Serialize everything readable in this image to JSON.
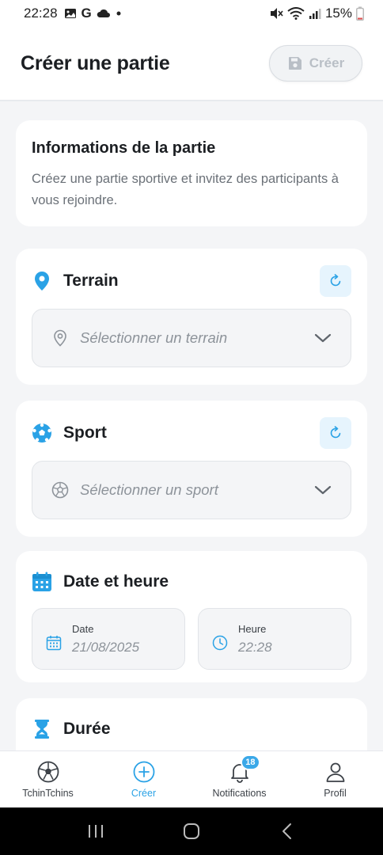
{
  "status": {
    "time": "22:28",
    "battery": "15%",
    "left_icons": [
      "gallery-icon",
      "google-g-icon",
      "cloud-icon",
      "dot-icon"
    ],
    "right_icons": [
      "mute-icon",
      "wifi-icon",
      "signal-icon",
      "battery-icon"
    ]
  },
  "header": {
    "title": "Créer une partie",
    "create_label": "Créer",
    "create_icon": "save-icon"
  },
  "info": {
    "title": "Informations de la partie",
    "description": "Créez une partie sportive et invitez des participants à vous rejoindre."
  },
  "terrain": {
    "label": "Terrain",
    "placeholder": "Sélectionner un terrain",
    "icon": "location-pin-icon"
  },
  "sport": {
    "label": "Sport",
    "placeholder": "Sélectionner un sport",
    "icon": "soccer-ball-icon"
  },
  "datetime": {
    "label": "Date et heure",
    "date_caption": "Date",
    "date_value": "21/08/2025",
    "time_caption": "Heure",
    "time_value": "22:28"
  },
  "duration": {
    "label": "Durée"
  },
  "tabs": [
    {
      "label": "TchinTchins",
      "icon": "soccer-ball-icon",
      "active": false
    },
    {
      "label": "Créer",
      "icon": "plus-circle-icon",
      "active": true
    },
    {
      "label": "Notifications",
      "icon": "bell-icon",
      "active": false,
      "badge": "18"
    },
    {
      "label": "Profil",
      "icon": "user-icon",
      "active": false
    }
  ],
  "colors": {
    "accent": "#2AA2E6",
    "background": "#F4F5F7",
    "card": "#FFFFFF",
    "refresh_bg": "#E6F4FD"
  }
}
